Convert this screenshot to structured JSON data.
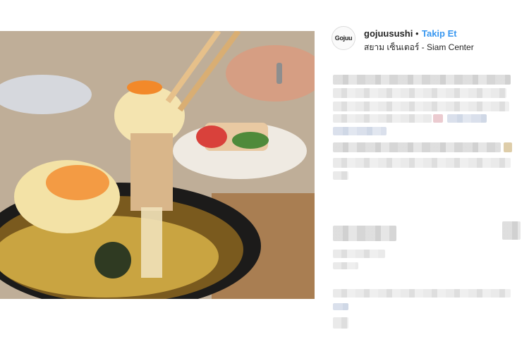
{
  "post": {
    "username": "gojuusushi",
    "separator": "•",
    "follow_label": "Takip Et",
    "location": "สยาม เซ็นเตอร์ - Siam Center",
    "avatar_text": "Gojuu"
  },
  "colors": {
    "follow_blue": "#3897f0",
    "text_dark": "#262626",
    "blur_grey": "#d2d2d2"
  },
  "photo": {
    "subject": "cheese-topped sushi roll lifted with chopsticks"
  }
}
